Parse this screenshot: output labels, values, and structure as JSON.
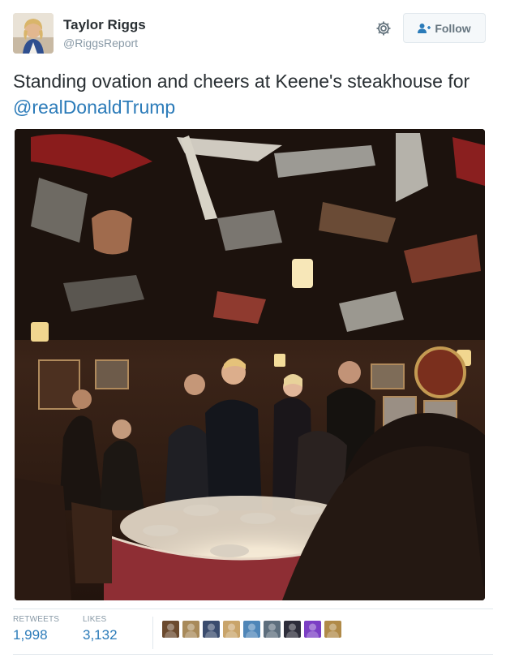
{
  "author": {
    "name": "Taylor Riggs",
    "handle": "@RiggsReport",
    "avatar_icon": "user-avatar"
  },
  "actions": {
    "settings_icon": "gear-icon",
    "follow_icon": "add-user-icon",
    "follow_label": "Follow"
  },
  "tweet": {
    "text": "Standing ovation and cheers at Keene's steakhouse for ",
    "mention": "@realDonaldTrump"
  },
  "stats": {
    "retweets_label": "RETWEETS",
    "retweets_value": "1,998",
    "likes_label": "LIKES",
    "likes_value": "3,132"
  },
  "likers": [
    {
      "color": "#6b4a2e"
    },
    {
      "color": "#a88a5a"
    },
    {
      "color": "#3a4c6e"
    },
    {
      "color": "#c9a46a"
    },
    {
      "color": "#4f86b8"
    },
    {
      "color": "#5d6e7d"
    },
    {
      "color": "#2d2d3a"
    },
    {
      "color": "#7b3fc4"
    },
    {
      "color": "#b08a48"
    }
  ],
  "colors": {
    "link": "#2b7bb9",
    "muted": "#8899a6",
    "border": "#e1e8ed"
  }
}
